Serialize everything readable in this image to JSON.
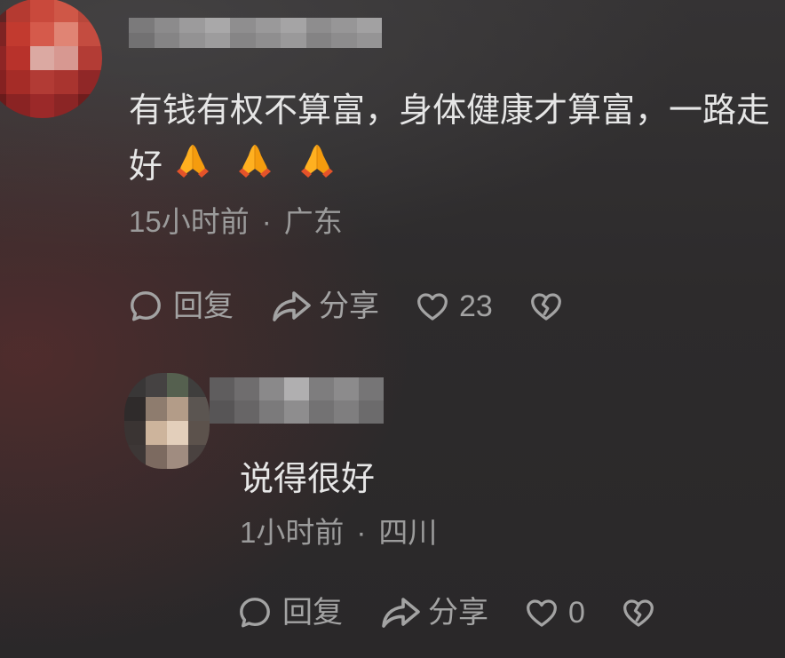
{
  "theme": {
    "background": "#2d2b2c",
    "text_color": "#e6e6e6",
    "meta_color": "#9b9b9b",
    "action_color": "#a3a3a3"
  },
  "comment": {
    "text": "有钱有权不算富，身体健康才算富，一路走好",
    "emojis": [
      "folded-hands",
      "folded-hands",
      "folded-hands"
    ],
    "time": "15小时前",
    "separator": "·",
    "location": "广东",
    "actions": {
      "reply_icon": "comment-bubble-icon",
      "reply_label": "回复",
      "share_icon": "share-arrow-icon",
      "share_label": "分享",
      "like_icon": "heart-outline-icon",
      "like_count": "23",
      "dislike_icon": "broken-heart-icon"
    },
    "replies": [
      {
        "text": "说得很好",
        "emojis": [],
        "time": "1小时前",
        "separator": "·",
        "location": "四川",
        "actions": {
          "reply_icon": "comment-bubble-icon",
          "reply_label": "回复",
          "share_icon": "share-arrow-icon",
          "share_label": "分享",
          "like_icon": "heart-outline-icon",
          "like_count": "0",
          "dislike_icon": "broken-heart-icon"
        }
      }
    ]
  }
}
